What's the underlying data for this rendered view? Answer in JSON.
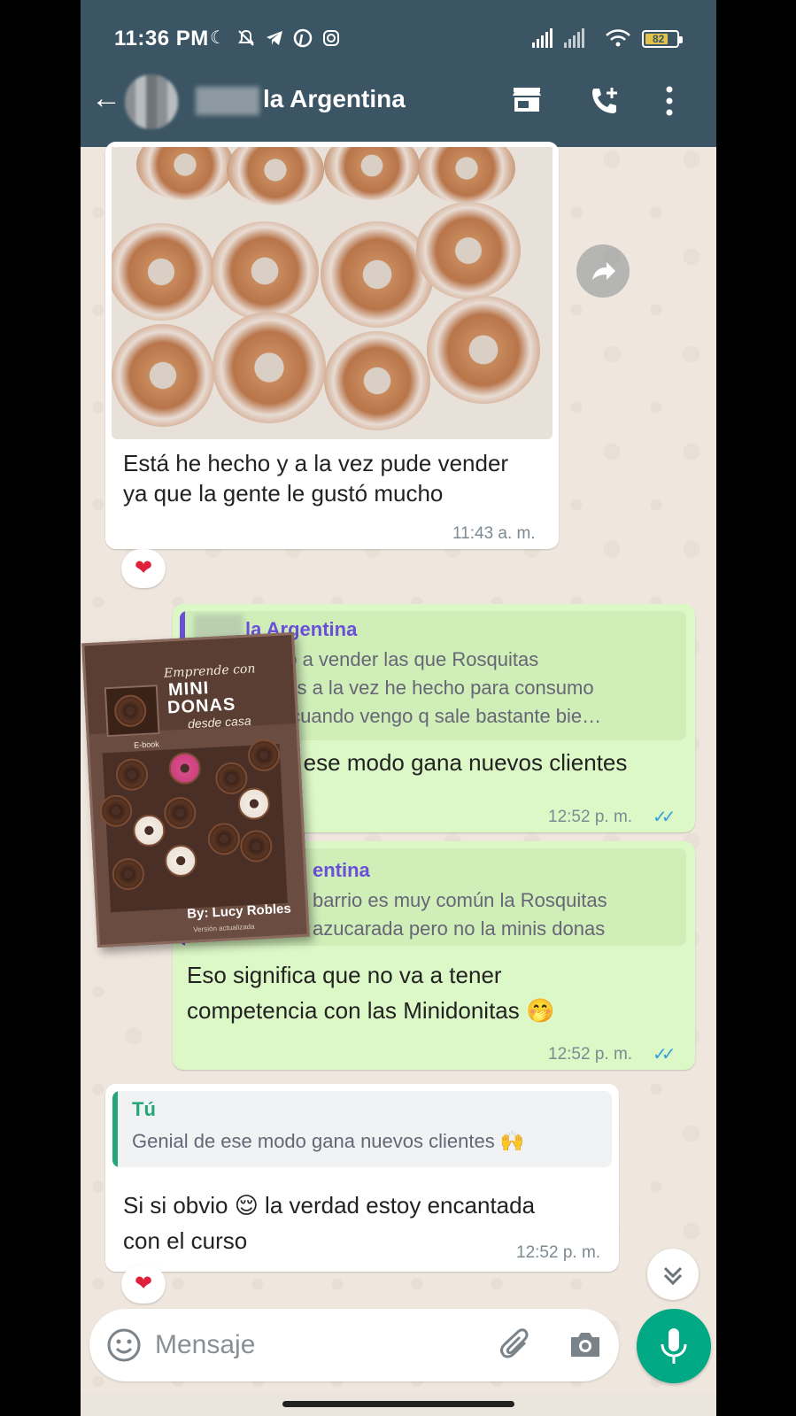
{
  "status_bar": {
    "time": "11:36 PM",
    "battery": "82"
  },
  "header": {
    "back_icon": "arrow-left-icon",
    "title": "la Argentina"
  },
  "messages": [
    {
      "id": "m1",
      "direction": "incoming",
      "text_line1": "Está he hecho y a la vez pude vender",
      "text_line2": "ya que la gente le gustó mucho",
      "time": "11:43 a. m.",
      "reaction": "❤"
    },
    {
      "id": "m2",
      "direction": "outgoing",
      "quote_name": "la Argentina",
      "quote_line1": "do a vender las que Rosquitas",
      "quote_line2": "das a la vez he hecho para consumo",
      "quote_line3": "y cuando vengo q sale bastante bie…",
      "text": "e ese modo gana nuevos clientes",
      "time": "12:52 p. m."
    },
    {
      "id": "m3",
      "direction": "outgoing",
      "quote_name": "entina",
      "quote_line1": "barrio es muy común la Rosquitas",
      "quote_line2": "azucarada pero no la minis donas",
      "text_line1": "Eso significa que no va a tener",
      "text_line2": "competencia con las Minidonitas 🤭",
      "time": "12:52 p. m."
    },
    {
      "id": "m4",
      "direction": "incoming",
      "quote_name": "Tú",
      "quote_line1": "Genial de ese modo gana nuevos clientes 🙌",
      "text_line1": "Si si obvio 😌 la verdad estoy encantada",
      "text_line2": "con el curso",
      "time": "12:52 p. m.",
      "reaction": "❤"
    }
  ],
  "ebook": {
    "line1": "Emprende con",
    "line2": "MINI",
    "line3": "DONAS",
    "line4": "desde casa",
    "tag": "E-book",
    "author": "By: Lucy Robles",
    "version": "Versión actualizada"
  },
  "composer": {
    "placeholder": "Mensaje"
  },
  "colors": {
    "header": "#3b5564",
    "outgoing": "#dcf8c6",
    "incoming": "#ffffff",
    "accent": "#00a884",
    "ticks": "#34a0dc"
  }
}
